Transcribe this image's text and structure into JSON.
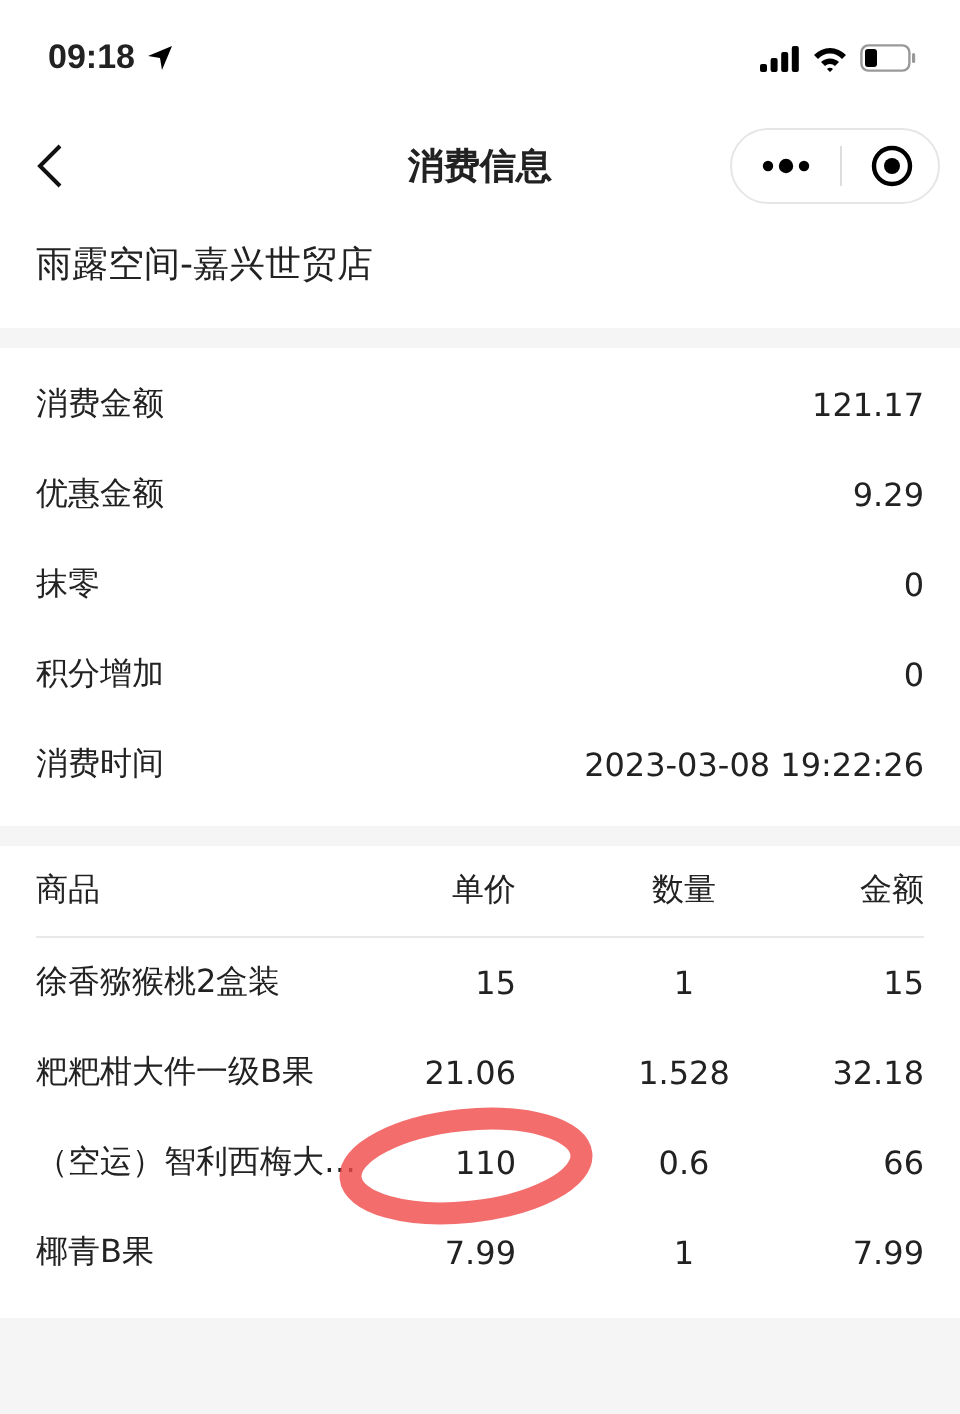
{
  "status_bar": {
    "time": "09:18"
  },
  "nav": {
    "title": "消费信息"
  },
  "store": {
    "name": "雨露空间-嘉兴世贸店"
  },
  "summary": [
    {
      "label": "消费金额",
      "value": "121.17"
    },
    {
      "label": "优惠金额",
      "value": "9.29"
    },
    {
      "label": "抹零",
      "value": "0"
    },
    {
      "label": "积分增加",
      "value": "0"
    },
    {
      "label": "消费时间",
      "value": "2023-03-08 19:22:26"
    }
  ],
  "table": {
    "columns": [
      "商品",
      "单价",
      "数量",
      "金额"
    ],
    "rows": [
      {
        "name": "徐香猕猴桃2盒装",
        "price": "15",
        "qty": "1",
        "amount": "15",
        "price_circled": false
      },
      {
        "name": "粑粑柑大件一级B果",
        "price": "21.06",
        "qty": "1.528",
        "amount": "32.18",
        "price_circled": false
      },
      {
        "name": "（空运）智利西梅大…",
        "price": "110",
        "qty": "0.6",
        "amount": "66",
        "price_circled": true
      },
      {
        "name": "椰青B果",
        "price": "7.99",
        "qty": "1",
        "amount": "7.99",
        "price_circled": false
      }
    ]
  }
}
